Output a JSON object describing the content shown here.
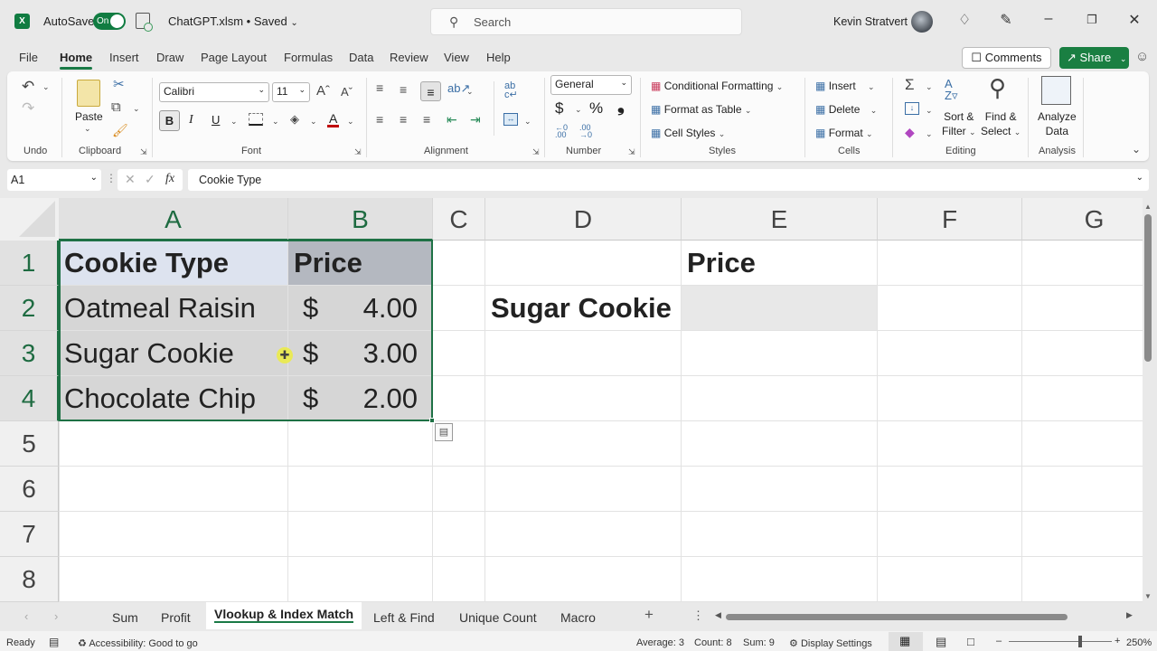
{
  "titlebar": {
    "app_icon": "excel-logo-icon",
    "app_icon_letter": "X",
    "autosave_label": "AutoSave",
    "autosave_state": "On",
    "filename": "ChatGPT.xlsm • Saved",
    "search_placeholder": "Search",
    "user_name": "Kevin Stratvert",
    "icons": [
      "diamond-icon",
      "pen-icon",
      "minimize-icon",
      "restore-icon",
      "close-icon"
    ]
  },
  "menu": {
    "items": [
      "File",
      "Home",
      "Insert",
      "Draw",
      "Page Layout",
      "Formulas",
      "Data",
      "Review",
      "View",
      "Help"
    ],
    "active": "Home",
    "comments_label": "Comments",
    "share_label": "Share"
  },
  "ribbon": {
    "undo": {
      "group": "Undo"
    },
    "clipboard": {
      "paste": "Paste",
      "group": "Clipboard"
    },
    "font": {
      "name": "Calibri",
      "size": "11",
      "bold": "B",
      "italic": "I",
      "underline": "U",
      "group": "Font",
      "font_color": "#c00000"
    },
    "alignment": {
      "group": "Alignment"
    },
    "number": {
      "format": "General",
      "currency": "$",
      "percent": "%",
      "comma": "❟",
      "group": "Number"
    },
    "styles": {
      "conditional": "Conditional Formatting",
      "format_table": "Format as Table",
      "cell_styles": "Cell Styles",
      "group": "Styles"
    },
    "cells": {
      "insert": "Insert",
      "delete": "Delete",
      "format": "Format",
      "group": "Cells"
    },
    "editing": {
      "sort1": "Sort &",
      "sort2": "Filter",
      "find1": "Find &",
      "find2": "Select",
      "group": "Editing"
    },
    "analysis": {
      "analyze1": "Analyze",
      "analyze2": "Data",
      "group": "Analysis"
    }
  },
  "formula_bar": {
    "name_box": "A1",
    "fx": "fx",
    "content": "Cookie Type"
  },
  "grid": {
    "columns": [
      "A",
      "B",
      "C",
      "D",
      "E",
      "F",
      "G"
    ],
    "rows": [
      "1",
      "2",
      "3",
      "4",
      "5",
      "6",
      "7",
      "8"
    ],
    "cells": {
      "A1": "Cookie Type",
      "B1": "Price",
      "A2": "Oatmeal Raisin",
      "B2_sym": "$",
      "B2_val": "4.00",
      "A3": "Sugar Cookie",
      "B3_sym": "$",
      "B3_val": "3.00",
      "A4": "Chocolate Chip",
      "B4_sym": "$",
      "B4_val": "2.00",
      "E1": "Price",
      "D2": "Sugar Cookie",
      "E2": ""
    },
    "selection": "A1:B4",
    "accent_color": "#1e7145"
  },
  "sheet_tabs": {
    "tabs": [
      "Sum",
      "Profit",
      "Vlookup & Index Match",
      "Left & Find",
      "Unique Count",
      "Macro"
    ],
    "active": "Vlookup & Index Match",
    "add_label": "+"
  },
  "status_bar": {
    "mode": "Ready",
    "accessibility": "Accessibility: Good to go",
    "average": "Average: 3",
    "count": "Count: 8",
    "sum": "Sum: 9",
    "display_settings": "Display Settings",
    "zoom": "250%"
  }
}
